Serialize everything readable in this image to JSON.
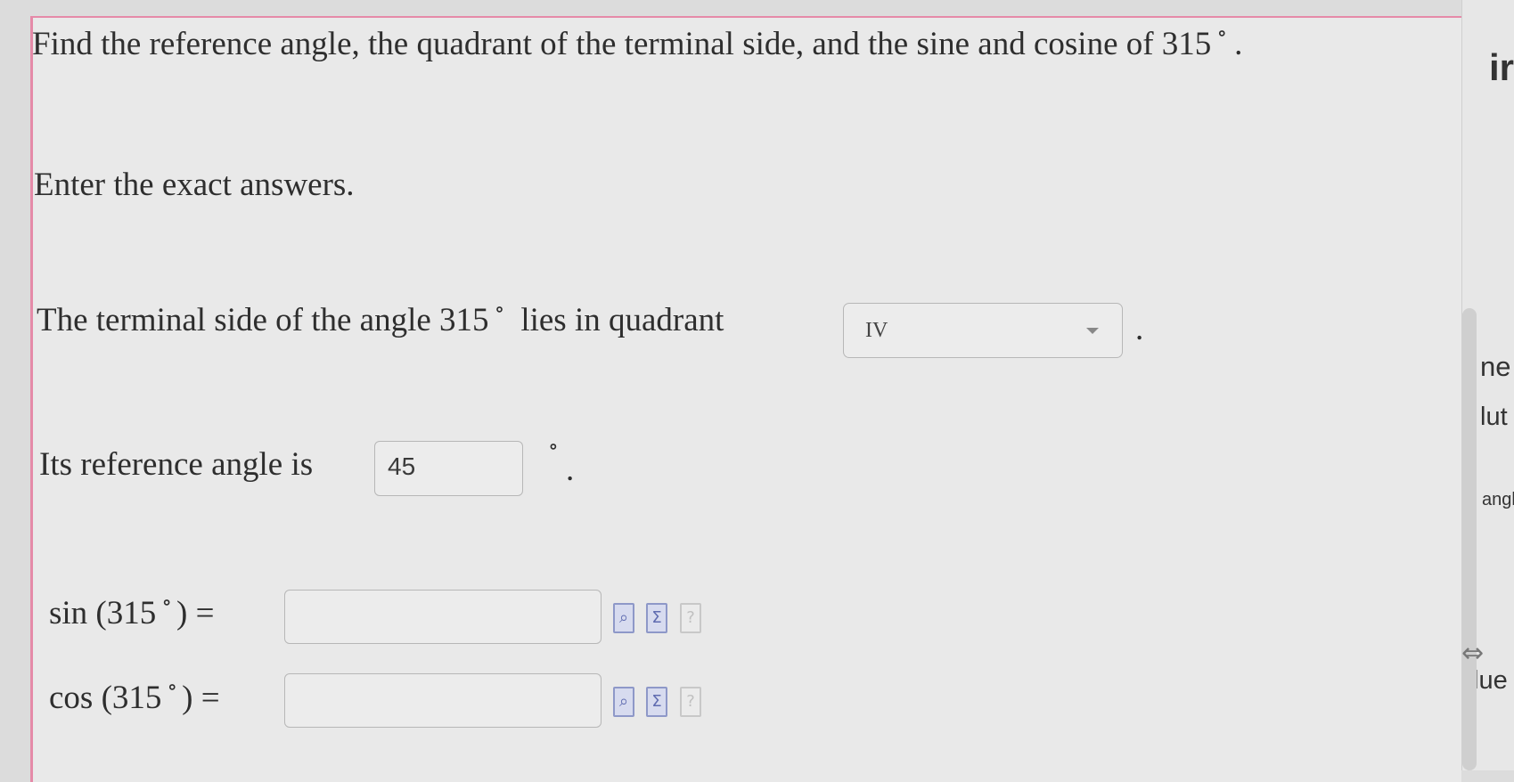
{
  "problem": {
    "prompt_prefix": "Find the reference angle, the quadrant of the terminal side, and the sine and cosine of 315",
    "prompt_degree": "∘",
    "prompt_suffix": ".",
    "instruction": "Enter the exact answers."
  },
  "quadrant": {
    "text_prefix": "The terminal side of the angle 315",
    "degree": "∘",
    "text_suffix": "lies in quadrant",
    "selected_value": "IV",
    "end_punct": "."
  },
  "reference": {
    "label": "Its reference angle is",
    "value": "45",
    "unit": "∘",
    "end_punct": "."
  },
  "sin": {
    "label_a": "sin (315",
    "degree": "∘",
    "label_b": ") =",
    "value": ""
  },
  "cos": {
    "label_a": "cos (315",
    "degree": "∘",
    "label_b": ") =",
    "value": ""
  },
  "side_panel": {
    "fragment_1": "ir",
    "fragment_2": "ne",
    "fragment_3": "lut",
    "fragment_4": "angl",
    "fragment_5": "lue"
  },
  "icons": [
    "preview-icon",
    "sigma-icon",
    "help-icon",
    "resize-handle-icon"
  ]
}
